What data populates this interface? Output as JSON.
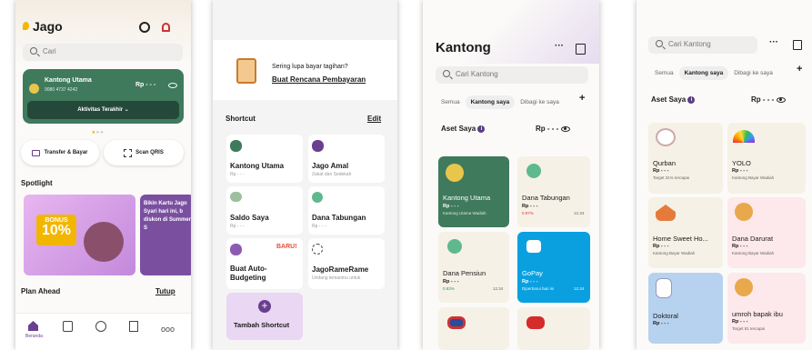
{
  "colors": {
    "accent_gold": "#f2b600",
    "kantong_green": "#3f7a5c",
    "purple": "#6a3f8f",
    "gopay_blue": "#0aa0e0"
  },
  "p1": {
    "logo": "Jago",
    "search": "Cari",
    "main_pocket_title": "Kantong Utama",
    "main_pocket_number": "9080 4737 4242",
    "main_pocket_amount": "Rp - - -",
    "activity_label": "Aktivitas Terakhir",
    "transfer_label": "Transfer & Bayar",
    "qris_label": "Scan QRIS",
    "spotlight": "Spotlight",
    "banner_bonus": "BONUS",
    "banner_percent": "10",
    "banner2_text": "Bikin Kartu Jago Syari hari ini, b diskon di Summer S",
    "plan_ahead": "Plan Ahead",
    "tutup": "Tutup",
    "nav": [
      "Beranda",
      "",
      "",
      "",
      ""
    ]
  },
  "p2": {
    "reminder_q": "Sering lupa bayar tagihan?",
    "reminder_link": "Buat Rencana Pembayaran",
    "shortcut": "Shortcut",
    "edit": "Edit",
    "cards": [
      {
        "t": "Kantong Utama",
        "s": "Rp - - -"
      },
      {
        "t": "Jago Amal",
        "s": "Zakat dan Sedekah"
      },
      {
        "t": "Saldo Saya",
        "s": "Rp - - -"
      },
      {
        "t": "Dana Tabungan",
        "s": "Rp - - -"
      },
      {
        "t": "Buat Auto-Budgeting",
        "s": "",
        "badge": "BARU!"
      },
      {
        "t": "JagoRameRame",
        "s": "Undang temanmu untuk"
      }
    ],
    "add_label": "Tambah Shortcut"
  },
  "p3": {
    "title": "Kantong",
    "search": "Cari Kantong",
    "tabs": [
      "Semua",
      "Kantong saya",
      "Dibagi ke saya"
    ],
    "aset": "Aset Saya",
    "aset_value": "Rp - - -",
    "pockets": [
      {
        "n": "Kantong Utama",
        "v": "Rp - - -",
        "s": "Kantong Utama Wadiah"
      },
      {
        "n": "Dana Tabungan",
        "v": "Rp - - -",
        "s": "0.97%",
        "d": "12.34"
      },
      {
        "n": "Dana Pensiun",
        "v": "Rp - - -",
        "s": "0.83%",
        "d": "12.34"
      },
      {
        "n": "GoPay",
        "v": "Rp - - -",
        "s": "Diperbarui hari ini",
        "d": "12.34"
      }
    ]
  },
  "p4": {
    "search": "Cari Kantong",
    "tabs": [
      "Semua",
      "Kantong saya",
      "Dibagi ke saya"
    ],
    "aset": "Aset Saya",
    "aset_value": "Rp - - -",
    "pockets": [
      {
        "n": "Qurban",
        "v": "Rp - - -",
        "s": "Target 31% tercapai"
      },
      {
        "n": "YOLO",
        "v": "Rp - - -",
        "s": "Kantong Bayar Wadiah"
      },
      {
        "n": "Home Sweet Ho...",
        "v": "Rp - - -",
        "s": "Kantong Bayar Wadiah"
      },
      {
        "n": "Dana Darurat",
        "v": "Rp - - -",
        "s": "Kantong Bayar Wadiah"
      },
      {
        "n": "Doktoral",
        "v": "Rp - - -",
        "s": ""
      },
      {
        "n": "umroh bapak ibu",
        "v": "Rp - - -",
        "s": "Target 81 tercapai"
      }
    ]
  }
}
